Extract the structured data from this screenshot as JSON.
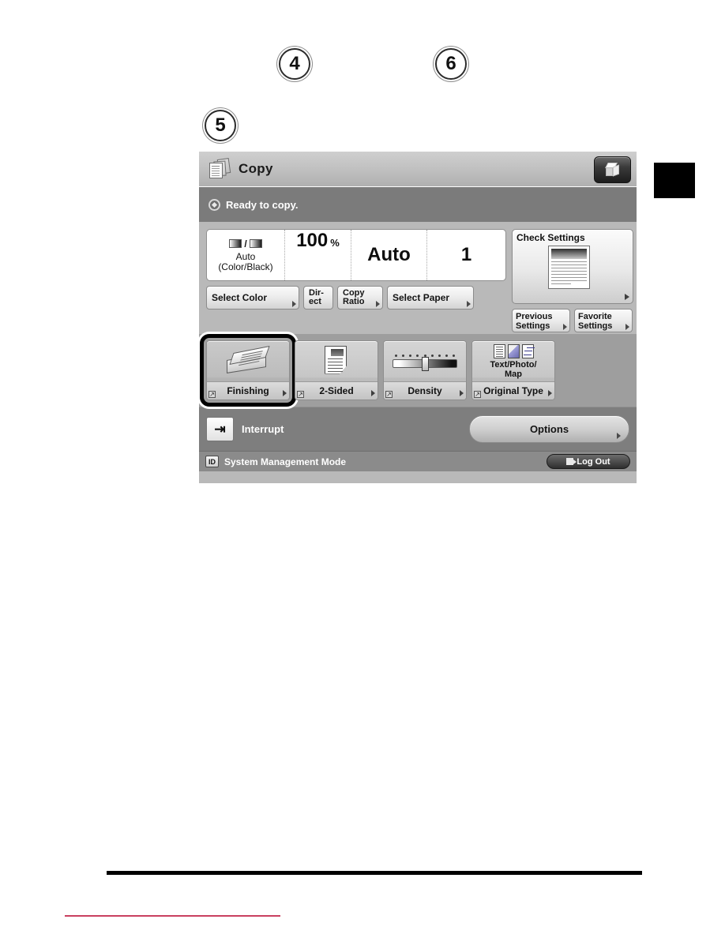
{
  "page": {
    "callouts": [
      {
        "number": "4"
      },
      {
        "number": "6"
      },
      {
        "number": "5"
      }
    ]
  },
  "lcd": {
    "titlebar": {
      "title": "Copy",
      "icon": "documents-stack-icon",
      "right_button_icon": "3d-cube-icon"
    },
    "statusbar": {
      "icon": "status-ready-icon",
      "message": "Ready to copy."
    },
    "settings": {
      "values": [
        {
          "name": "color-mode",
          "icon": "color-black-gradient-icon",
          "line1": "Auto",
          "line2": "(Color/Black)"
        },
        {
          "name": "copy-ratio",
          "value": "100",
          "unit": "%"
        },
        {
          "name": "paper-size",
          "value": "Auto"
        },
        {
          "name": "copy-count",
          "value": "1"
        }
      ],
      "buttons": [
        {
          "name": "select-color",
          "label": "Select Color"
        },
        {
          "name": "direct",
          "label_line1": "Dir-",
          "label_line2": "ect"
        },
        {
          "name": "copy-ratio",
          "label_line1": "Copy",
          "label_line2": "Ratio"
        },
        {
          "name": "select-paper",
          "label": "Select Paper"
        }
      ]
    },
    "check_settings": {
      "label": "Check Settings",
      "thumbnail_icon": "document-preview-icon",
      "previous_settings": {
        "line1": "Previous",
        "line2": "Settings"
      },
      "favorite_settings": {
        "line1": "Favorite",
        "line2": "Settings"
      }
    },
    "functions": [
      {
        "name": "finishing",
        "label": "Finishing",
        "icon": "finisher-tray-icon",
        "selected": true
      },
      {
        "name": "2-sided",
        "label": "2-Sided",
        "icon": "two-sided-page-icon",
        "selected": false
      },
      {
        "name": "density",
        "label": "Density",
        "icon": "density-slider-icon",
        "selected": false
      },
      {
        "name": "original-type",
        "label": "Original Type",
        "value_line1": "Text/Photo/",
        "value_line2": "Map",
        "icon": "original-type-icon",
        "selected": false
      }
    ],
    "interrupt": {
      "icon": "interrupt-icon",
      "label": "Interrupt"
    },
    "options": {
      "label": "Options"
    },
    "footer": {
      "id_badge": "ID",
      "mode_text": "System Management Mode",
      "logout_label": "Log Out",
      "logout_icon": "logout-door-icon"
    }
  },
  "colors": {
    "panel_bg": "#b9b9b9",
    "status_bg": "#7b7b7b",
    "func_strip_bg": "#9e9e9e",
    "footer_bg": "#8b8b8b",
    "selection_ring": "#000000",
    "rule_black": "#000000",
    "rule_red": "#c94060"
  }
}
